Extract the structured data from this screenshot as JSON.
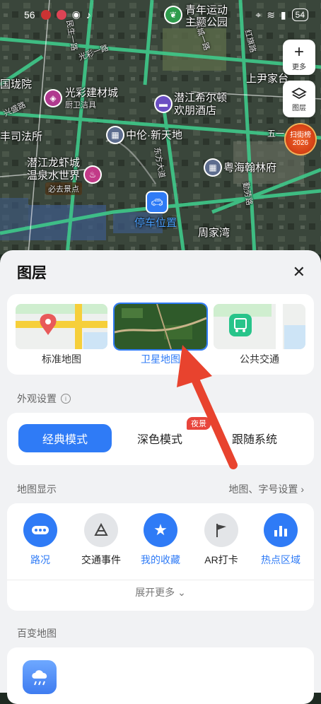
{
  "status_bar": {
    "time": "56",
    "battery": "54"
  },
  "map": {
    "labels": {
      "youth_park": "青年运动\n主题公园",
      "shangyin": "上尹家台",
      "guangcai": "光彩建材城",
      "guangcai_sub": "厨卫洁具",
      "hilton": "潜江希尔顿\n欢朋酒店",
      "zhonglun": "中伦·新天地",
      "court": "丰司法所",
      "longxia": "潜江龙虾城\n温泉水世界",
      "must_go": "必去景点",
      "yuehai": "粤海翰林府",
      "parking": "停车位置",
      "zhoujiawan": "周家湾",
      "wuyi": "五一",
      "guoling": "国珑院",
      "minsheng_rd": "民生一路",
      "guangcai_rd": "光彩一路",
      "xingcheng_rd": "兴盛路",
      "dongcheng_rd": "东城一路",
      "qinlao_rd": "勤劳路",
      "hongqi_rd": "红旗路",
      "dongfang_rd": "东方大道"
    },
    "more_label": "更多",
    "layer_label": "图层",
    "rank_label": "扫街榜",
    "rank_year": "2026"
  },
  "sheet": {
    "title": "图层",
    "layers": [
      {
        "label": "标准地图"
      },
      {
        "label": "卫星地图"
      },
      {
        "label": "公共交通"
      }
    ],
    "appearance_title": "外观设置",
    "modes": [
      "经典模式",
      "深色模式",
      "跟随系统"
    ],
    "night_badge": "夜景",
    "display_title": "地图显示",
    "display_settings_link": "地图、字号设置",
    "display_items": [
      {
        "label": "路况"
      },
      {
        "label": "交通事件"
      },
      {
        "label": "我的收藏"
      },
      {
        "label": "AR打卡"
      },
      {
        "label": "热点区域"
      }
    ],
    "expand_more": "展开更多",
    "variety_title": "百变地图"
  },
  "colors": {
    "accent": "#2f7bf6",
    "road": "#3fc98a",
    "arrow": "#e8432e"
  }
}
